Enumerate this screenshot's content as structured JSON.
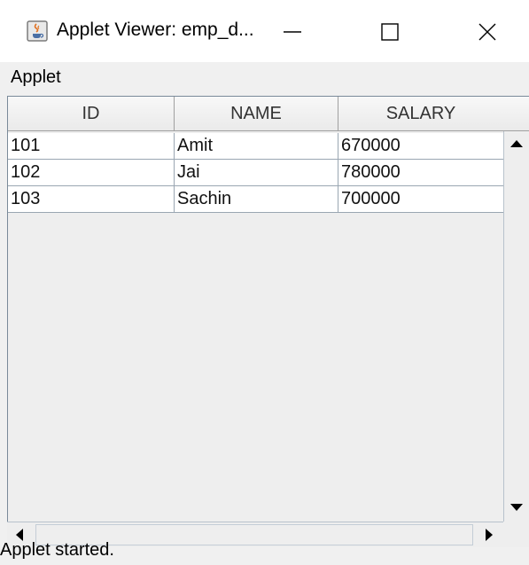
{
  "window": {
    "title": "Applet Viewer: emp_d...",
    "icon": "java-cup-icon",
    "controls": {
      "minimize_icon": "minimize-icon",
      "maximize_icon": "maximize-icon",
      "close_icon": "close-icon"
    }
  },
  "menubar": {
    "items": [
      {
        "label": "Applet"
      }
    ]
  },
  "table": {
    "columns": [
      "ID",
      "NAME",
      "SALARY"
    ],
    "rows": [
      [
        "101",
        "Amit",
        "670000"
      ],
      [
        "102",
        "Jai",
        "780000"
      ],
      [
        "103",
        "Sachin",
        "700000"
      ]
    ]
  },
  "status": {
    "text": "Applet started."
  },
  "colors": {
    "window_bg": "#f0f0f0",
    "cell_bg": "#ffffff",
    "grid_line": "#9aa6b2"
  }
}
